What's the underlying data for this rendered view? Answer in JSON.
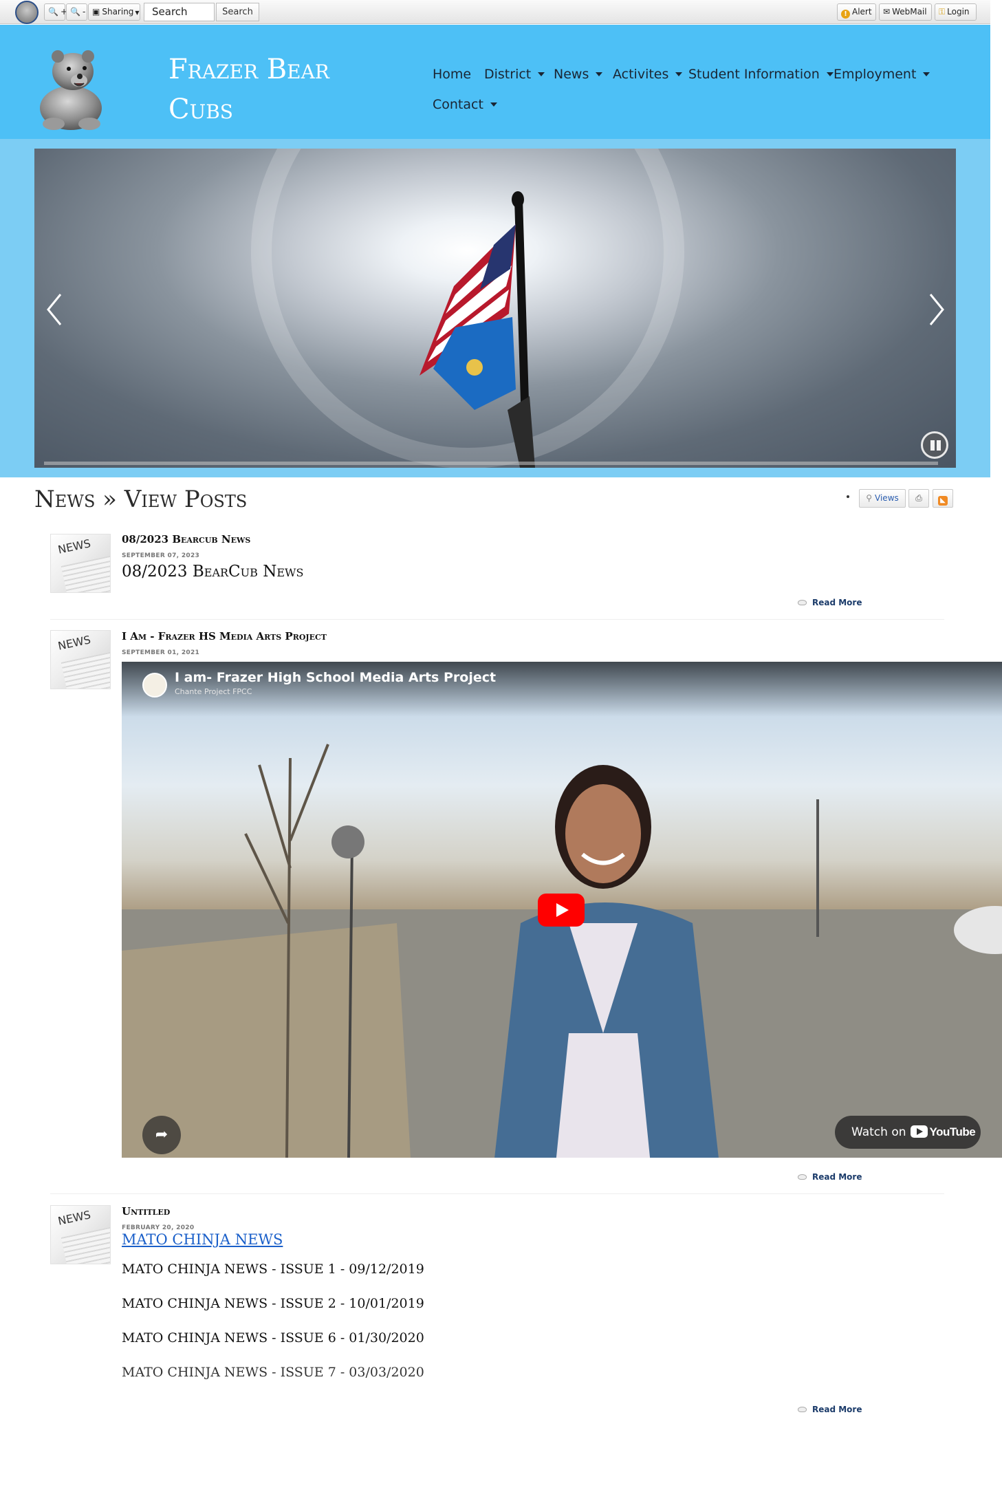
{
  "toolbar": {
    "zoom_in": "+",
    "zoom_out": "-",
    "sharing": "Sharing",
    "search_value": "Search",
    "search_button": "Search",
    "alert": "Alert",
    "webmail": "WebMail",
    "login": "Login"
  },
  "header": {
    "title_line1": "Frazer Bear",
    "title_line2": "Cubs",
    "nav": [
      {
        "label": "Home",
        "dropdown": false
      },
      {
        "label": "District",
        "dropdown": true
      },
      {
        "label": "News",
        "dropdown": true
      },
      {
        "label": "Activites",
        "dropdown": true
      },
      {
        "label": "Student Information",
        "dropdown": true
      },
      {
        "label": "Employment",
        "dropdown": true
      },
      {
        "label": "Contact",
        "dropdown": true
      }
    ]
  },
  "page": {
    "title": "News » View Posts",
    "views_label": "Views"
  },
  "posts": [
    {
      "thumb_label": "NEWS",
      "title": "08/2023 Bearcub News",
      "date": "SEPTEMBER 07, 2023",
      "heading": "08/2023 BearCub News",
      "read_more": "Read More"
    },
    {
      "thumb_label": "NEWS",
      "title": "I Am - Frazer HS Media Arts Project",
      "date": "SEPTEMBER 01, 2021",
      "video": {
        "title": "I am- Frazer High School Media Arts Project",
        "channel": "Chante Project FPCC",
        "watch_on": "Watch on",
        "youtube": "YouTube"
      },
      "read_more": "Read More"
    },
    {
      "thumb_label": "NEWS",
      "title": "Untitled",
      "date": "FEBRUARY 20, 2020",
      "link_heading": "MATO CHINJA NEWS",
      "issues": [
        "MATO CHINJA NEWS - ISSUE 1 - 09/12/2019",
        "MATO CHINJA NEWS - ISSUE 2 - 10/01/2019",
        "MATO CHINJA NEWS - ISSUE 6 - 01/30/2020",
        "MATO CHINJA NEWS - ISSUE 7 - 03/03/2020"
      ],
      "read_more": "Read More"
    }
  ],
  "colors": {
    "header_bg": "#4dc0f6",
    "slide_band": "#7ccdf4",
    "link": "#1a5fc9",
    "read_more": "#1b3b6a"
  },
  "icons": [
    "bear-logo-icon",
    "zoom-in-icon",
    "zoom-out-icon",
    "share-icon",
    "alert-icon",
    "mail-icon",
    "key-icon",
    "chevron-left-icon",
    "chevron-right-icon",
    "pause-icon",
    "views-icon",
    "print-icon",
    "rss-icon",
    "play-icon",
    "comment-icon"
  ]
}
